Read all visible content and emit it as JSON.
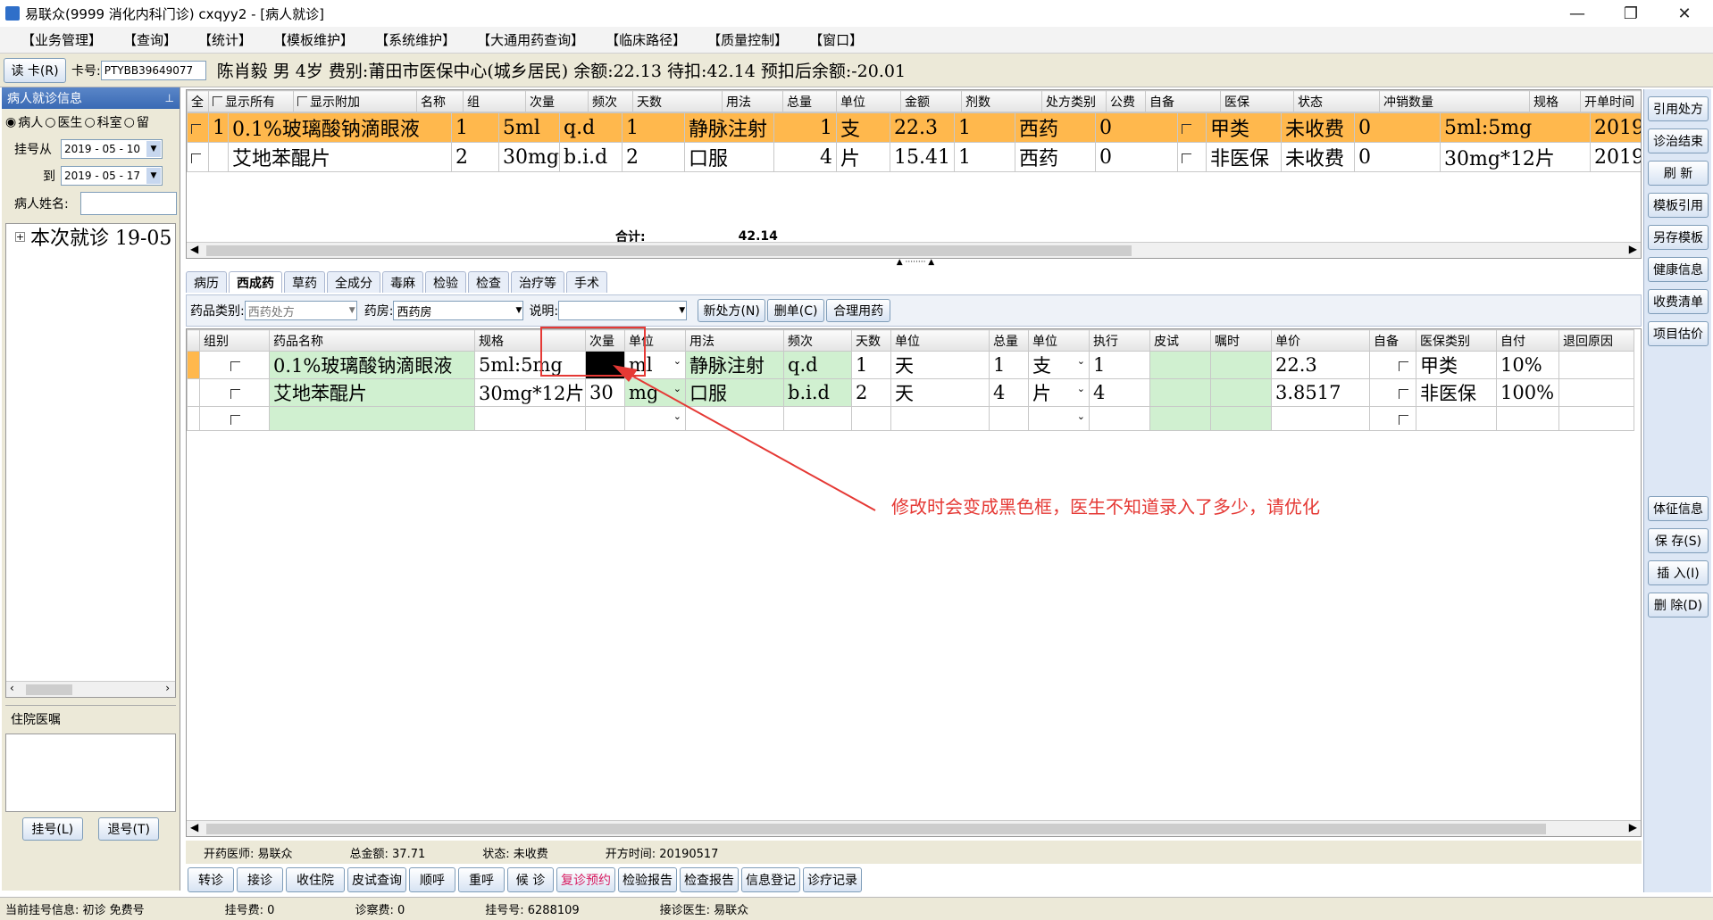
{
  "window": {
    "title": "易联众(9999 消化内科门诊) cxqyy2 - [病人就诊]",
    "minimize": "—",
    "restore": "❐",
    "close": "✕"
  },
  "menu": [
    "【业务管理】",
    "【查询】",
    "【统计】",
    "【模板维护】",
    "【系统维护】",
    "【大通用药查询】",
    "【临床路径】",
    "【质量控制】",
    "【窗口】"
  ],
  "patient": {
    "read_card_label": "读 卡(R)",
    "card_label": "卡号:",
    "card_no": "PTYBB39649077",
    "summary": "陈肖毅 男 4岁 费别:莆田市医保中心(城乡居民) 余额:22.13 待扣:42.14 预扣后余额:-20.01"
  },
  "left": {
    "panel_title": "病人就诊信息",
    "pin_icon": "pin-icon",
    "radios": [
      {
        "label": "病人",
        "checked": true
      },
      {
        "label": "医生",
        "checked": false
      },
      {
        "label": "科室",
        "checked": false
      },
      {
        "label": "留",
        "checked": false
      }
    ],
    "from_label": "挂号从",
    "from_date": "2019 - 05 - 10",
    "to_label": "到",
    "to_date": "2019 - 05 - 17",
    "name_label": "病人姓名:",
    "name_value": "",
    "tree_item": "本次就诊  19-05",
    "inpatient_title": "住院医嘱",
    "register_btn": "挂号(L)",
    "unregister_btn": "退号(T)"
  },
  "top_grid": {
    "headers": [
      "全",
      "显示所有",
      "显示附加",
      "名称",
      "组",
      "次量",
      "频次",
      "天数",
      "用法",
      "总量",
      "单位",
      "金额",
      "剂数",
      "处方类别",
      "公费",
      "自备",
      "医保",
      "状态",
      "冲销数量",
      "规格",
      "开单时间"
    ],
    "rows": [
      [
        "1",
        "0.1%玻璃酸钠滴眼液",
        "1",
        "5ml",
        "q.d",
        "1",
        "静脉注射",
        "1",
        "支",
        "22.3",
        "1",
        "西药",
        "0",
        "",
        "甲类",
        "未收费",
        "0",
        "5ml:5mg",
        "2019"
      ],
      [
        "",
        "艾地苯醌片",
        "2",
        "30mg",
        "b.i.d",
        "2",
        "口服",
        "4",
        "片",
        "15.41",
        "1",
        "西药",
        "0",
        "",
        "非医保",
        "未收费",
        "0",
        "30mg*12片",
        "2019"
      ]
    ],
    "total_label": "合计:",
    "total_value": "42.14"
  },
  "tabs": [
    "病历",
    "西成药",
    "草药",
    "全成分",
    "毒麻",
    "检验",
    "检查",
    "治疗等",
    "手术"
  ],
  "active_tab": "西成药",
  "filter": {
    "category_label": "药品类别:",
    "category_value": "西药处方",
    "pharmacy_label": "药房:",
    "pharmacy_value": "西药房",
    "note_label": "说明:",
    "note_value": "",
    "new_rx_btn": "新处方(N)",
    "delete_rx_btn": "删单(C)",
    "rational_btn": "合理用药"
  },
  "edit_grid": {
    "headers": [
      "组别",
      "药品名称",
      "规格",
      "次量",
      "单位",
      "用法",
      "频次",
      "天数",
      "单位",
      "总量",
      "单位",
      "执行",
      "皮试",
      "嘱时",
      "单价",
      "自备",
      "医保类别",
      "自付",
      "退回原因"
    ],
    "rows": [
      [
        "0.1%玻璃酸钠滴眼液",
        "5ml:5mg",
        "",
        "ml",
        "静脉注射",
        "q.d",
        "1",
        "天",
        "1",
        "支",
        "1",
        "",
        "",
        "22.3",
        "甲类",
        "10%"
      ],
      [
        "艾地苯醌片",
        "30mg*12片",
        "30",
        "mg",
        "口服",
        "b.i.d",
        "2",
        "天",
        "4",
        "片",
        "4",
        "",
        "",
        "3.8517",
        "非医保",
        "100%"
      ]
    ]
  },
  "annotation": "修改时会变成黑色框，医生不知道录入了多少，请优化",
  "footer": {
    "doctor": "开药医师: 易联众",
    "total": "总金额: 37.71",
    "status": "状态: 未收费",
    "time": "开方时间: 20190517"
  },
  "bottom_buttons": [
    "转诊",
    "接诊",
    "收住院",
    "皮试查询",
    "顺呼",
    "重呼",
    "候 诊",
    "复诊预约",
    "检验报告",
    "检查报告",
    "信息登记",
    "诊疗记录"
  ],
  "right_buttons_top": [
    "引用处方",
    "诊治结束",
    "刷 新",
    "模板引用",
    "另存模板",
    "健康信息",
    "收费清单",
    "项目估价"
  ],
  "right_buttons_bottom": [
    "体征信息",
    "保 存(S)",
    "插 入(I)",
    "删 除(D)"
  ],
  "status_bar": {
    "reg_info": "当前挂号信息:   初诊 免费号",
    "reg_fee": "挂号费:   0",
    "exam_fee": "诊察费: 0",
    "reg_no": "挂号号:   6288109",
    "doctor": "接诊医生:   易联众"
  }
}
